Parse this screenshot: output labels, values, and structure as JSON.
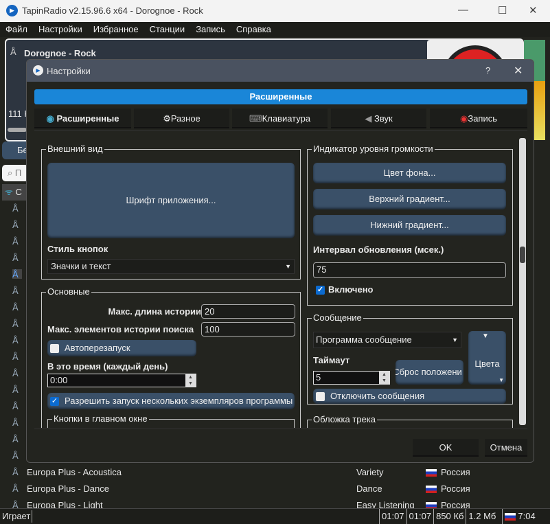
{
  "window": {
    "title": "TapinRadio v2.15.96.6   x64  - Dorognoe - Rock"
  },
  "menu": [
    "Файл",
    "Настройки",
    "Избранное",
    "Станции",
    "Запись",
    "Справка"
  ],
  "player": {
    "station": "Dorognoe - Rock",
    "bitrate_partial": "111 K",
    "tab_partial": "Бе",
    "search_partial": "П",
    "cat_partial": "С"
  },
  "dialog": {
    "title": "Настройки",
    "help": "?",
    "header": "Расширенные",
    "tabs": [
      "Расширенные",
      "Разное",
      "Клавиатура",
      "Звук",
      "Запись"
    ],
    "appearance": {
      "legend": "Внешний вид",
      "font_button": "Шрифт приложения...",
      "button_style_label": "Стиль кнопок",
      "button_style_value": "Значки и текст"
    },
    "basic": {
      "legend": "Основные",
      "max_history_label": "Макс. длина истории",
      "max_history": "20",
      "max_search_label": "Макс. элементов истории поиска",
      "max_search": "100",
      "autorestart": "Автоперезапуск",
      "autorestart_checked": false,
      "time_label": "В это время (каждый день)",
      "time": "0:00",
      "multi_instance": "Разрешить запуск нескольких экземпляров программы",
      "multi_instance_checked": true,
      "buttons_legend": "Кнопки в главном окне"
    },
    "volume": {
      "legend": "Индикатор уровня громкости",
      "bg_color": "Цвет фона...",
      "top_gradient": "Верхний градиент...",
      "bottom_gradient": "Нижний градиент...",
      "interval_label": "Интервал обновления (мсек.)",
      "interval": "75",
      "enabled": "Включено",
      "enabled_checked": true
    },
    "message": {
      "legend": "Сообщение",
      "type": "Программа сообщение",
      "timeout_label": "Таймаут",
      "timeout": "5",
      "reset_pos": "Сброс положени",
      "colors": "Цвета",
      "disable": "Отключить сообщения",
      "disable_checked": false
    },
    "cover_legend": "Обложка трека",
    "ok": "OK",
    "cancel": "Отмена"
  },
  "stations": [
    {
      "name": "Europa Plus - Acoustica",
      "genre": "Variety",
      "country": "Россия"
    },
    {
      "name": "Europa Plus - Dance",
      "genre": "Dance",
      "country": "Россия"
    },
    {
      "name": "Europa Plus - Light",
      "genre": "Easy Listening",
      "country": "Россия"
    }
  ],
  "status": {
    "state": "Играет",
    "t1": "01:07",
    "t2": "01:07",
    "s1": "850 Кб",
    "s2": "1.2 Мб",
    "clock": "7:04"
  },
  "colors": {
    "accent": "#1a86d8",
    "button": "#3a5068"
  }
}
